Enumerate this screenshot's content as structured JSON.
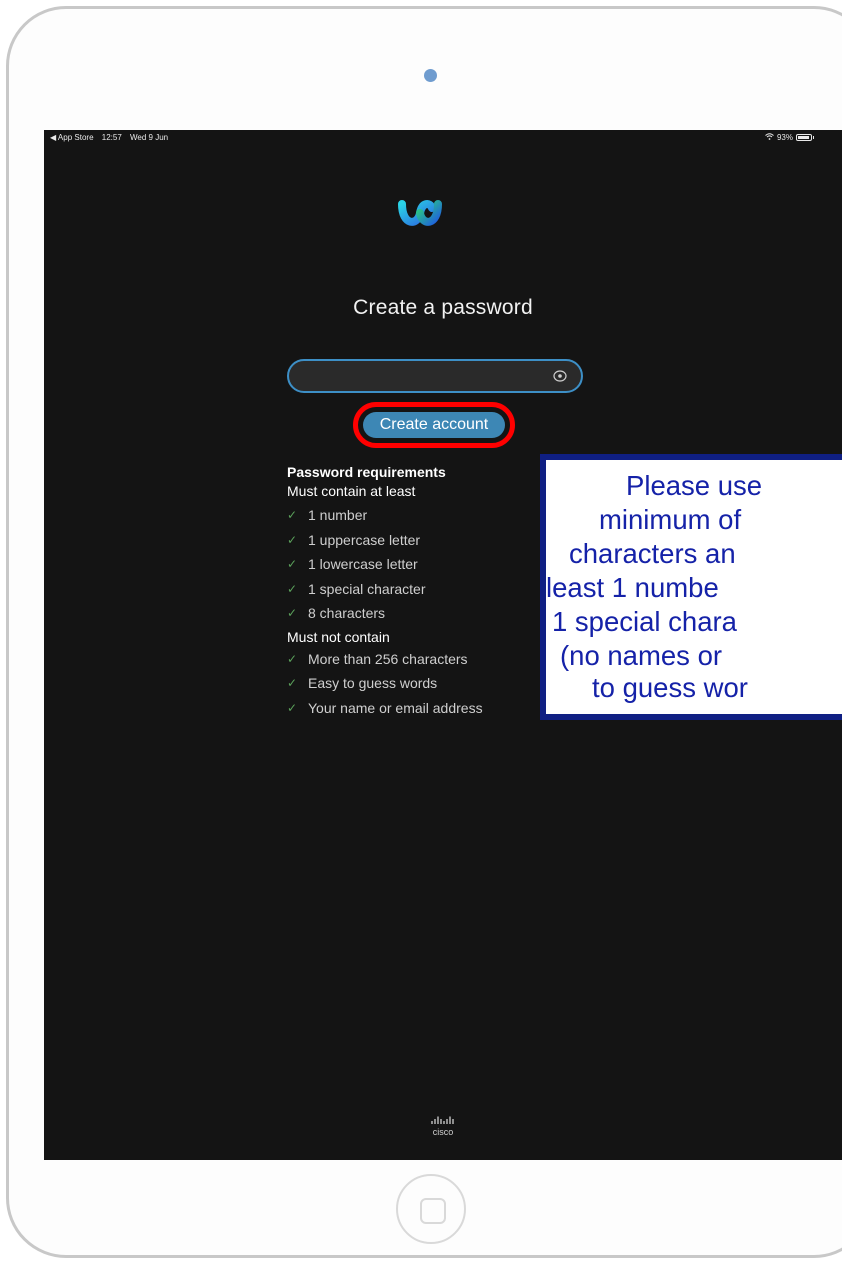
{
  "status_bar": {
    "back_app": "◀ App Store",
    "time": "12:57",
    "date": "Wed 9 Jun",
    "battery": "93%"
  },
  "page": {
    "title": "Create a password",
    "password_placeholder": "",
    "create_button": "Create account"
  },
  "requirements": {
    "heading": "Password requirements",
    "must_contain_label": "Must contain at least",
    "must_contain": [
      "1 number",
      "1 uppercase letter",
      "1 lowercase letter",
      "1 special character",
      "8 characters"
    ],
    "must_not_contain_label": "Must not contain",
    "must_not_contain": [
      "More than 256 characters",
      "Easy to guess words",
      "Your name or email address"
    ]
  },
  "footer": {
    "brand": "cisco"
  },
  "callout": {
    "lines": [
      "Please use",
      "minimum of",
      "characters an",
      "least 1 numbe",
      "1 special chara",
      "(no names or",
      "to guess wor"
    ]
  },
  "colors": {
    "screen_bg": "#141414",
    "accent": "#3d87b5",
    "highlight": "#ff0000",
    "callout_border": "#0f1f83",
    "callout_text": "#1522a8"
  }
}
